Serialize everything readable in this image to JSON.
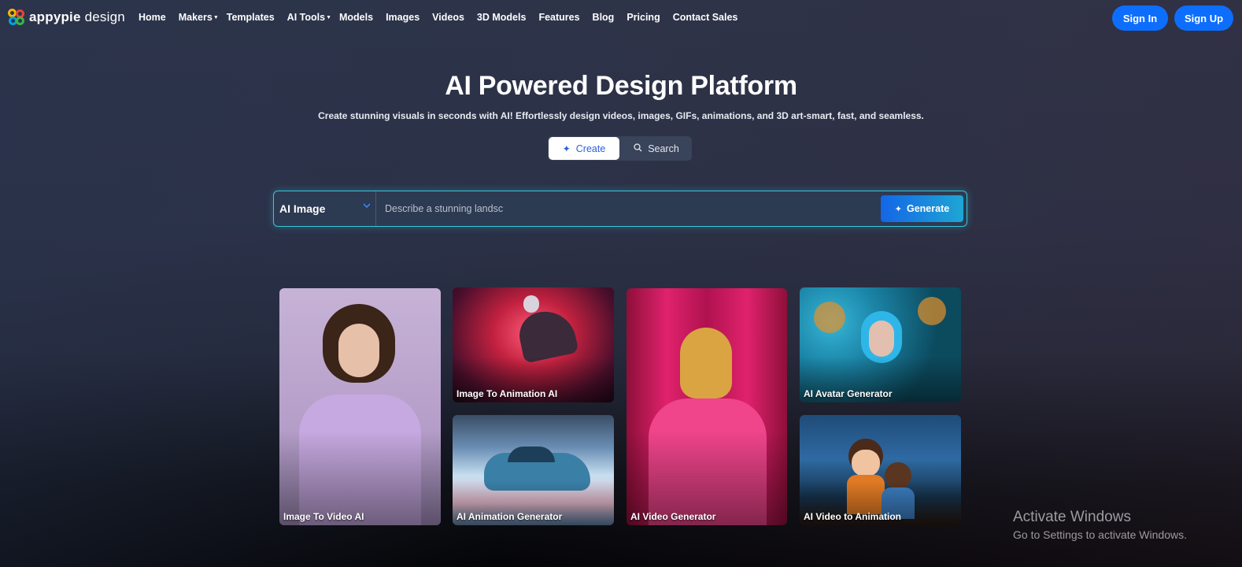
{
  "brand": {
    "name_bold": "appypie",
    "name_light": "design"
  },
  "nav": {
    "links": [
      "Home",
      "Makers",
      "Templates",
      "AI Tools",
      "Models",
      "Images",
      "Videos",
      "3D Models",
      "Features",
      "Blog",
      "Pricing",
      "Contact Sales"
    ],
    "sign_in": "Sign In",
    "sign_up": "Sign Up"
  },
  "hero": {
    "title": "AI Powered Design Platform",
    "subtitle": "Create stunning visuals in seconds with AI! Effortlessly design videos, images, GIFs, animations, and 3D art-smart, fast, and seamless."
  },
  "mode_toggle": {
    "create": "Create",
    "search": "Search",
    "selected": "Create"
  },
  "prompt": {
    "type_selected": "AI Image",
    "placeholder": "Describe a stunning landsc",
    "generate": "Generate"
  },
  "cards": [
    {
      "caption": "Image To Video AI"
    },
    {
      "caption": "Image To Animation AI"
    },
    {
      "caption": "AI Video Generator"
    },
    {
      "caption": "AI Avatar Generator"
    },
    {
      "caption": "AI Animation Generator"
    },
    {
      "caption": "AI Video to Animation"
    }
  ],
  "watermark": {
    "line1": "Activate Windows",
    "line2": "Go to Settings to activate Windows."
  },
  "colors": {
    "primary": "#0d6efd",
    "accent": "#36c6d9"
  },
  "icons": [
    "sparkle-icon",
    "search-icon",
    "chevron-down-icon",
    "caret-down-icon"
  ]
}
